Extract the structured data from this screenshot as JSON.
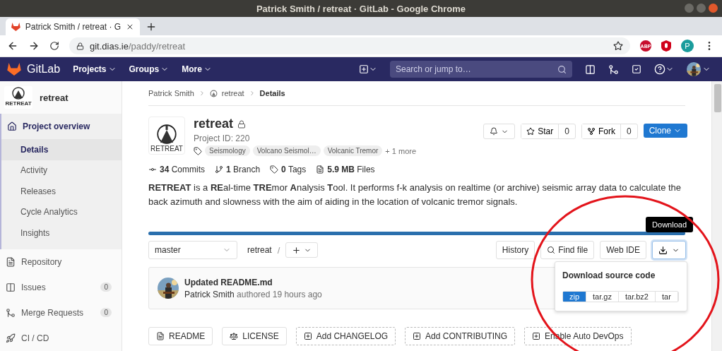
{
  "window": {
    "title": "Patrick Smith / retreat · GitLab - Google Chrome"
  },
  "browser": {
    "tab_title": "Patrick Smith / retreat · G",
    "url_host": "git.dias.ie",
    "url_path": "/paddy/retreat",
    "adblock": "ABP",
    "profile": "P"
  },
  "navbar": {
    "brand": "GitLab",
    "menus": [
      "Projects",
      "Groups",
      "More"
    ],
    "search": {
      "placeholder": "Search or jump to…"
    }
  },
  "sidebar": {
    "project": {
      "name": "retreat",
      "avatar_text": "RETREAT"
    },
    "items": [
      {
        "label": "Project overview",
        "selected": true,
        "expanded": true,
        "children": [
          {
            "label": "Details",
            "selected": true
          },
          {
            "label": "Activity",
            "selected": false
          },
          {
            "label": "Releases",
            "selected": false
          },
          {
            "label": "Cycle Analytics",
            "selected": false
          },
          {
            "label": "Insights",
            "selected": false
          }
        ]
      },
      {
        "label": "Repository",
        "selected": false
      },
      {
        "label": "Issues",
        "selected": false,
        "count": "0"
      },
      {
        "label": "Merge Requests",
        "selected": false,
        "count": "0"
      },
      {
        "label": "CI / CD",
        "selected": false
      }
    ]
  },
  "breadcrumb": [
    "Patrick Smith",
    "retreat",
    "Details"
  ],
  "project": {
    "name": "retreat",
    "private": true,
    "avatar_text": "RETREAT",
    "id": "Project ID: 220",
    "topics": [
      "Seismology",
      "Volcano Seismol…",
      "Volcanic Tremor"
    ],
    "more_topics": "+ 1 more",
    "star": {
      "label": "Star",
      "count": "0"
    },
    "fork": {
      "label": "Fork",
      "count": "0"
    },
    "clone": "Clone"
  },
  "stats": [
    "**34** Commits",
    "**1** Branch",
    "**0** Tags",
    "**5.9 MB** Files"
  ],
  "description": "**RETREAT** is a **RE**al-time **TRE**mor **A**nalysis **T**ool. It performs f-k analysis on realtime (or archive) seismic array data to calculate the back azimuth and slowness with the aim of aiding in the location of volcanic tremor signals.",
  "repo": {
    "branch": "master",
    "path": "retreat",
    "separator": "/",
    "buttons": [
      "History",
      "Find file",
      "Web IDE"
    ],
    "tooltip": "Download",
    "download": {
      "title": "Download source code",
      "formats": [
        {
          "label": "zip",
          "selected": true
        },
        {
          "label": "tar.gz",
          "selected": false
        },
        {
          "label": "tar.bz2",
          "selected": false
        },
        {
          "label": "tar",
          "selected": false
        }
      ]
    }
  },
  "commit": {
    "title": "Updated README.md",
    "author": "Patrick Smith",
    "meta": "authored 19 hours ago"
  },
  "file_buttons": [
    {
      "label": "README",
      "kind": "file"
    },
    {
      "label": "LICENSE",
      "kind": "license"
    },
    {
      "label": "Add CHANGELOG",
      "kind": "add"
    },
    {
      "label": "Add CONTRIBUTING",
      "kind": "add"
    },
    {
      "label": "Enable Auto DevOps",
      "kind": "add"
    }
  ]
}
